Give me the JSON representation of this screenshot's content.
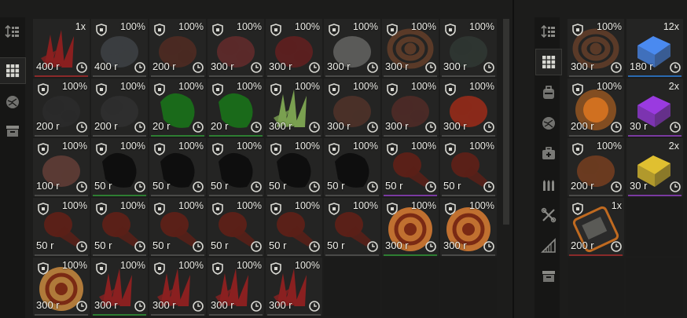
{
  "colors": {
    "accent_white": "#f2f2ec",
    "bar_default": "#4a4a48",
    "bar_red": "#8a2a2a",
    "bar_green": "#2e7d32",
    "bar_purple": "#7a3aa0",
    "bar_blue": "#2a6ab0"
  },
  "left_sidebar": [
    {
      "icon": "sort-icon",
      "active": false
    },
    {
      "icon": "grid-icon",
      "active": true
    },
    {
      "icon": "ore-icon",
      "active": false
    },
    {
      "icon": "container-icon",
      "active": false
    }
  ],
  "right_sidebar": [
    {
      "icon": "sort-icon",
      "active": false
    },
    {
      "icon": "grid-icon",
      "active": true
    },
    {
      "icon": "backpack-icon",
      "active": false
    },
    {
      "icon": "ore-icon",
      "active": false
    },
    {
      "icon": "medkit-icon",
      "active": false
    },
    {
      "icon": "ammo-icon",
      "active": false
    },
    {
      "icon": "tools-icon",
      "active": false
    },
    {
      "icon": "ruler-icon",
      "active": false
    },
    {
      "icon": "container-icon",
      "active": false
    }
  ],
  "left_items": [
    {
      "label": "1x",
      "price": "400 r",
      "art": "spike",
      "color": "#8a1f1f",
      "bar": "bar_red",
      "shield": false
    },
    {
      "label": "100%",
      "price": "400 r",
      "art": "blob",
      "color": "#3a3d40",
      "bar": "bar_default",
      "shield": true
    },
    {
      "label": "100%",
      "price": "200 r",
      "art": "blob",
      "color": "#4a2a22",
      "bar": "bar_default",
      "shield": true
    },
    {
      "label": "100%",
      "price": "300 r",
      "art": "blob",
      "color": "#5a2a2a",
      "bar": "bar_default",
      "shield": true
    },
    {
      "label": "100%",
      "price": "300 r",
      "art": "blob",
      "color": "#5a2020",
      "bar": "bar_default",
      "shield": true
    },
    {
      "label": "100%",
      "price": "300 r",
      "art": "blob",
      "color": "#5a5a58",
      "bar": "bar_default",
      "shield": true
    },
    {
      "label": "100%",
      "price": "300 r",
      "art": "coil",
      "color": "#5a3a28",
      "bar": "bar_default",
      "shield": true
    },
    {
      "label": "100%",
      "price": "300 r",
      "art": "blob",
      "color": "#2e3531",
      "bar": "bar_default",
      "shield": true
    },
    {
      "label": "100%",
      "price": "200 r",
      "art": "blob",
      "color": "#2a2a2a",
      "bar": "bar_default",
      "shield": true
    },
    {
      "label": "100%",
      "price": "200 r",
      "art": "blob",
      "color": "#2e2e2e",
      "bar": "bar_default",
      "shield": true
    },
    {
      "label": "100%",
      "price": "20 r",
      "art": "leaf",
      "color": "#1a6a1a",
      "bar": "bar_green",
      "shield": true
    },
    {
      "label": "100%",
      "price": "20 r",
      "art": "leaf",
      "color": "#1a6a1a",
      "bar": "bar_green",
      "shield": true
    },
    {
      "label": "100%",
      "price": "300 r",
      "art": "spike",
      "color": "#7aa050",
      "bar": "bar_default",
      "shield": true
    },
    {
      "label": "100%",
      "price": "300 r",
      "art": "blob",
      "color": "#4a3028",
      "bar": "bar_default",
      "shield": true
    },
    {
      "label": "100%",
      "price": "300 r",
      "art": "blob",
      "color": "#4a2a26",
      "bar": "bar_default",
      "shield": true
    },
    {
      "label": "100%",
      "price": "300 r",
      "art": "blob",
      "color": "#8a2a1a",
      "bar": "bar_default",
      "shield": true
    },
    {
      "label": "100%",
      "price": "100 r",
      "art": "blob",
      "color": "#5a3a34",
      "bar": "bar_default",
      "shield": true
    },
    {
      "label": "100%",
      "price": "50 r",
      "art": "leaf",
      "color": "#0e0e0e",
      "bar": "bar_green",
      "shield": true
    },
    {
      "label": "100%",
      "price": "50 r",
      "art": "leaf",
      "color": "#0e0e0e",
      "bar": "bar_default",
      "shield": true
    },
    {
      "label": "100%",
      "price": "50 r",
      "art": "leaf",
      "color": "#0e0e0e",
      "bar": "bar_default",
      "shield": true
    },
    {
      "label": "100%",
      "price": "50 r",
      "art": "leaf",
      "color": "#0e0e0e",
      "bar": "bar_default",
      "shield": true
    },
    {
      "label": "100%",
      "price": "50 r",
      "art": "leaf",
      "color": "#0e0e0e",
      "bar": "bar_default",
      "shield": true
    },
    {
      "label": "100%",
      "price": "50 r",
      "art": "drum",
      "color": "#5a2018",
      "bar": "bar_purple",
      "shield": true
    },
    {
      "label": "100%",
      "price": "50 r",
      "art": "drum",
      "color": "#5a2018",
      "bar": "bar_default",
      "shield": true
    },
    {
      "label": "100%",
      "price": "50 r",
      "art": "drum",
      "color": "#5a2018",
      "bar": "bar_default",
      "shield": true
    },
    {
      "label": "100%",
      "price": "50 r",
      "art": "drum",
      "color": "#5a2018",
      "bar": "bar_default",
      "shield": true
    },
    {
      "label": "100%",
      "price": "50 r",
      "art": "drum",
      "color": "#5a2018",
      "bar": "bar_default",
      "shield": true
    },
    {
      "label": "100%",
      "price": "50 r",
      "art": "drum",
      "color": "#5a2018",
      "bar": "bar_default",
      "shield": true
    },
    {
      "label": "100%",
      "price": "50 r",
      "art": "drum",
      "color": "#5a2018",
      "bar": "bar_default",
      "shield": true
    },
    {
      "label": "100%",
      "price": "50 r",
      "art": "drum",
      "color": "#5a2018",
      "bar": "bar_default",
      "shield": true
    },
    {
      "label": "100%",
      "price": "300 r",
      "art": "swirl",
      "color": "#c07030",
      "bar": "bar_green",
      "shield": true
    },
    {
      "label": "100%",
      "price": "300 r",
      "art": "swirl",
      "color": "#c07030",
      "bar": "bar_default",
      "shield": true
    },
    {
      "label": "100%",
      "price": "300 r",
      "art": "swirl",
      "color": "#b07a3a",
      "bar": "bar_default",
      "shield": true
    },
    {
      "label": "100%",
      "price": "300 r",
      "art": "spike",
      "color": "#8a2020",
      "bar": "bar_green",
      "shield": true
    },
    {
      "label": "100%",
      "price": "300 r",
      "art": "spike",
      "color": "#8a2020",
      "bar": "bar_default",
      "shield": true
    },
    {
      "label": "100%",
      "price": "300 r",
      "art": "spike",
      "color": "#8a2020",
      "bar": "bar_default",
      "shield": true
    },
    {
      "label": "100%",
      "price": "300 r",
      "art": "spike",
      "color": "#8a2020",
      "bar": "bar_default",
      "shield": true
    }
  ],
  "right_items": [
    {
      "label": "100%",
      "price": "300 r",
      "art": "coil",
      "color": "#5a3a28",
      "bar": "bar_default",
      "shield": true
    },
    {
      "label": "12x",
      "price": "180 r",
      "art": "cube",
      "color": "#4a8af0",
      "bar": "bar_blue",
      "shield": false
    },
    {
      "label": "100%",
      "price": "200 r",
      "art": "orb",
      "color": "#d07020",
      "bar": "bar_default",
      "shield": true
    },
    {
      "label": "2x",
      "price": "30 r",
      "art": "cube",
      "color": "#9a3ae0",
      "bar": "bar_purple",
      "shield": false
    },
    {
      "label": "100%",
      "price": "200 r",
      "art": "blob",
      "color": "#6a3a20",
      "bar": "bar_default",
      "shield": true
    },
    {
      "label": "2x",
      "price": "30 r",
      "art": "cube",
      "color": "#e0c030",
      "bar": "bar_purple",
      "shield": false
    },
    {
      "label": "1x",
      "price": "200 r",
      "art": "tablet",
      "color": "#c06a20",
      "bar": "bar_red",
      "shield": true
    }
  ]
}
